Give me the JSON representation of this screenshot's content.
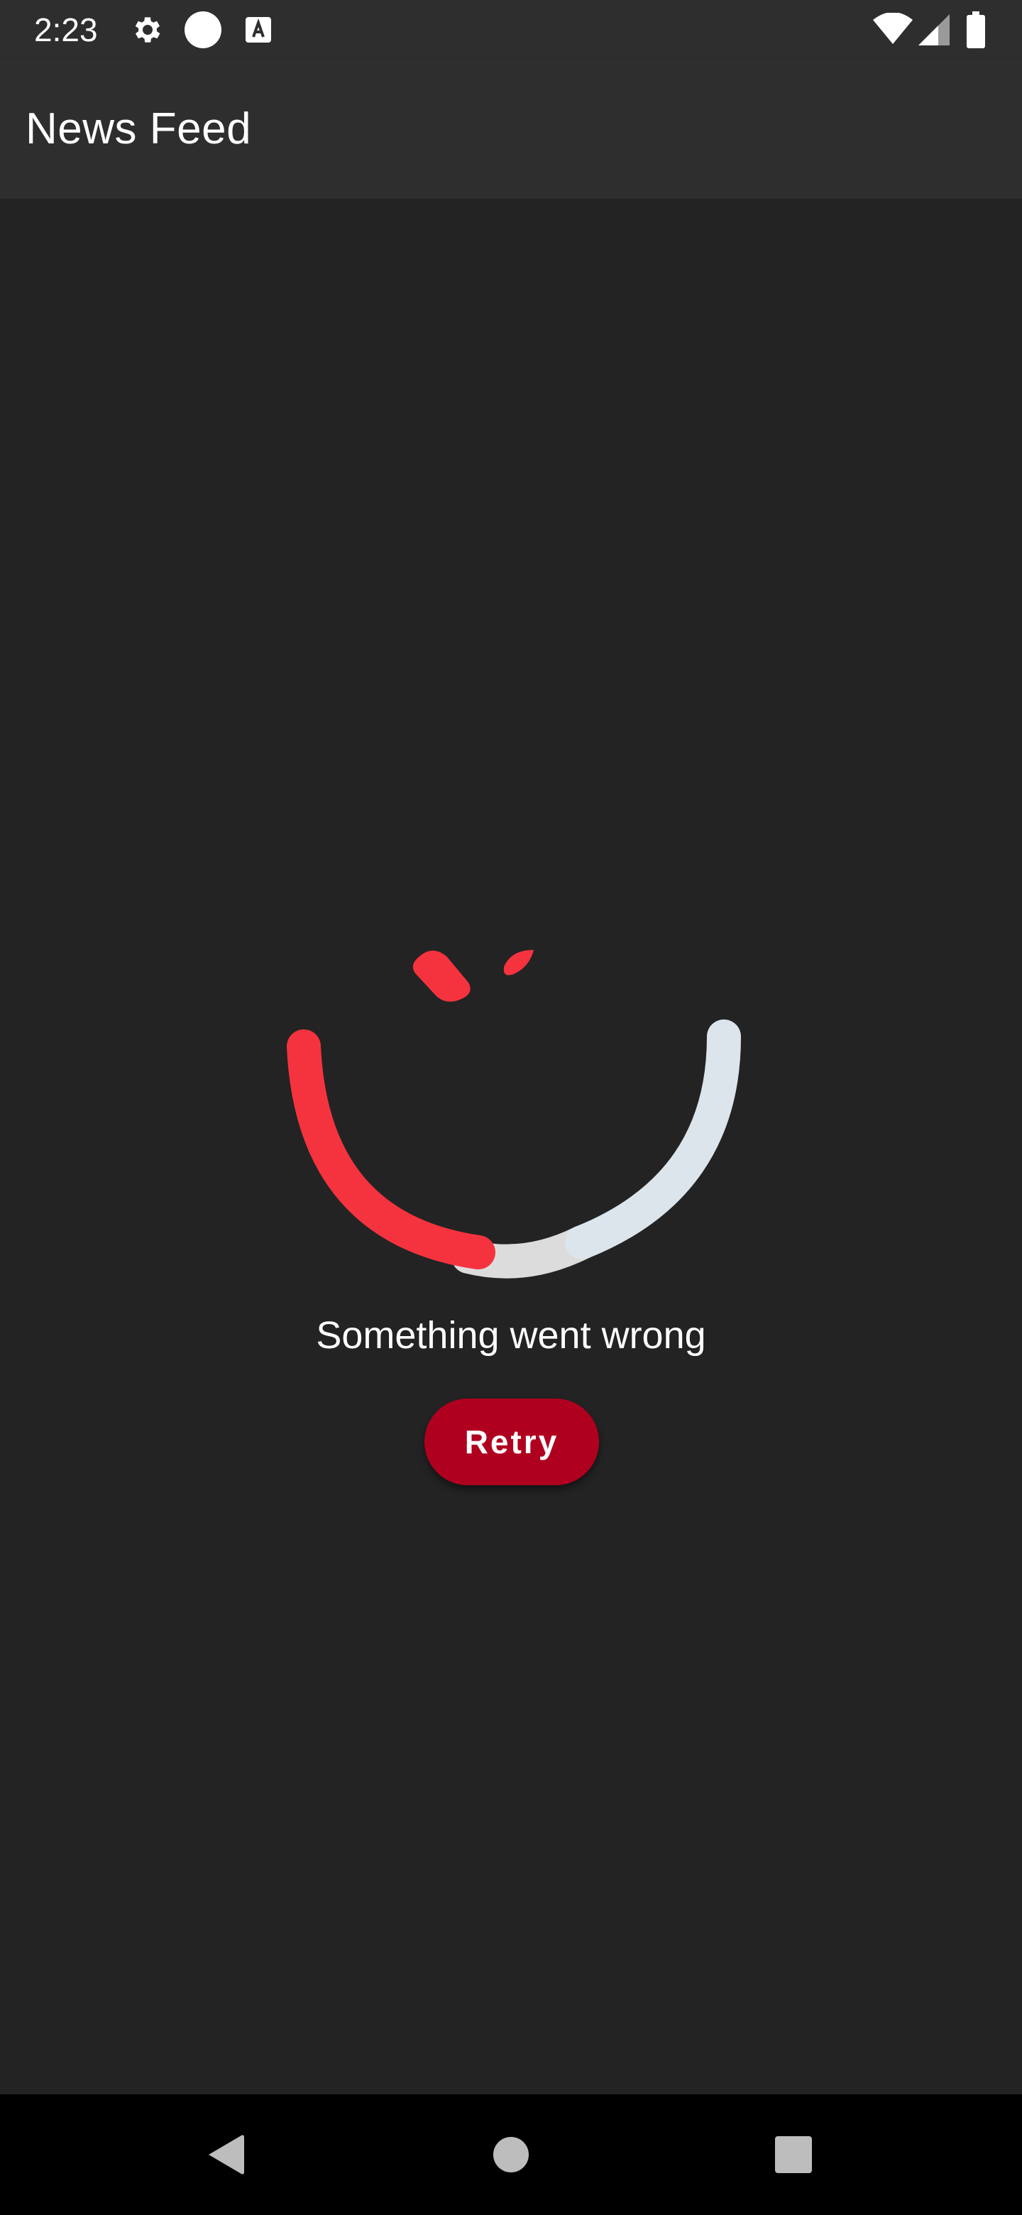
{
  "status_bar": {
    "time": "2:23",
    "icons_left": [
      "settings-gear-icon",
      "circle-dot-icon",
      "text-a-icon"
    ],
    "icons_right": [
      "wifi-icon",
      "cellular-signal-icon",
      "battery-icon"
    ]
  },
  "app_bar": {
    "title": "News Feed"
  },
  "error_state": {
    "message": "Something went wrong",
    "retry_label": "Retry",
    "illustration": "sad-face-illustration"
  },
  "nav_bar": {
    "back": "back-icon",
    "home": "home-icon",
    "recents": "recents-icon"
  },
  "colors": {
    "background": "#232323",
    "bar_background": "#2e2e2e",
    "accent_red": "#f5333f",
    "button_red": "#b00020",
    "arc_gray": "#dcdcdc",
    "arc_light_blue": "#dde5ec"
  }
}
